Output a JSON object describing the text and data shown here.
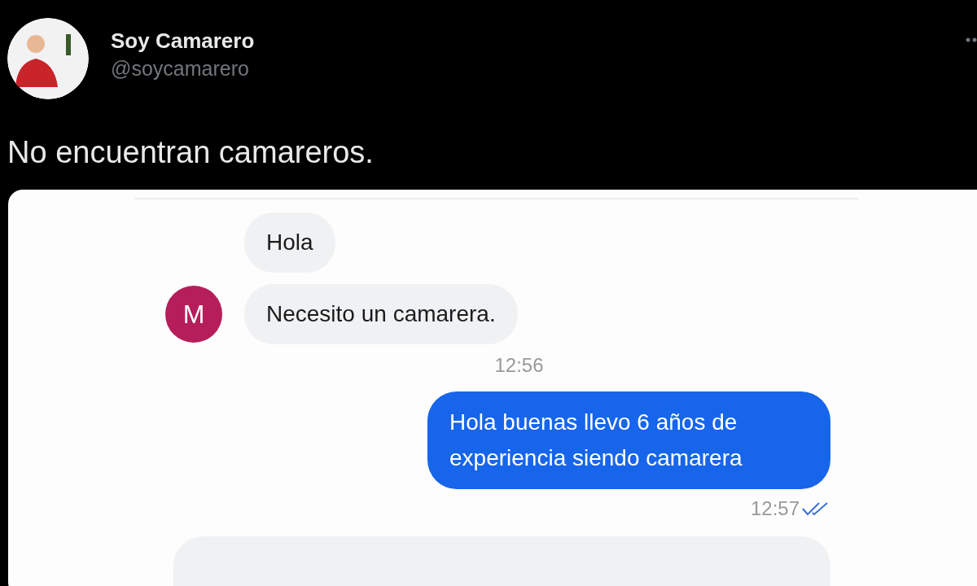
{
  "tweet": {
    "author": {
      "name": "Soy Camarero",
      "handle": "@soycamarero"
    },
    "text": "No encuentran camareros."
  },
  "chat": {
    "items": [
      {
        "kind": "received",
        "text": "Hola"
      },
      {
        "kind": "received",
        "text": "Necesito un camarera.",
        "avatar": "M"
      },
      {
        "kind": "time",
        "text": "12:56"
      },
      {
        "kind": "sent",
        "text": "Hola buenas llevo 6 años de experiencia siendo camarera"
      },
      {
        "kind": "sent_time",
        "text": "12:57",
        "read": true
      },
      {
        "kind": "partial"
      }
    ]
  }
}
